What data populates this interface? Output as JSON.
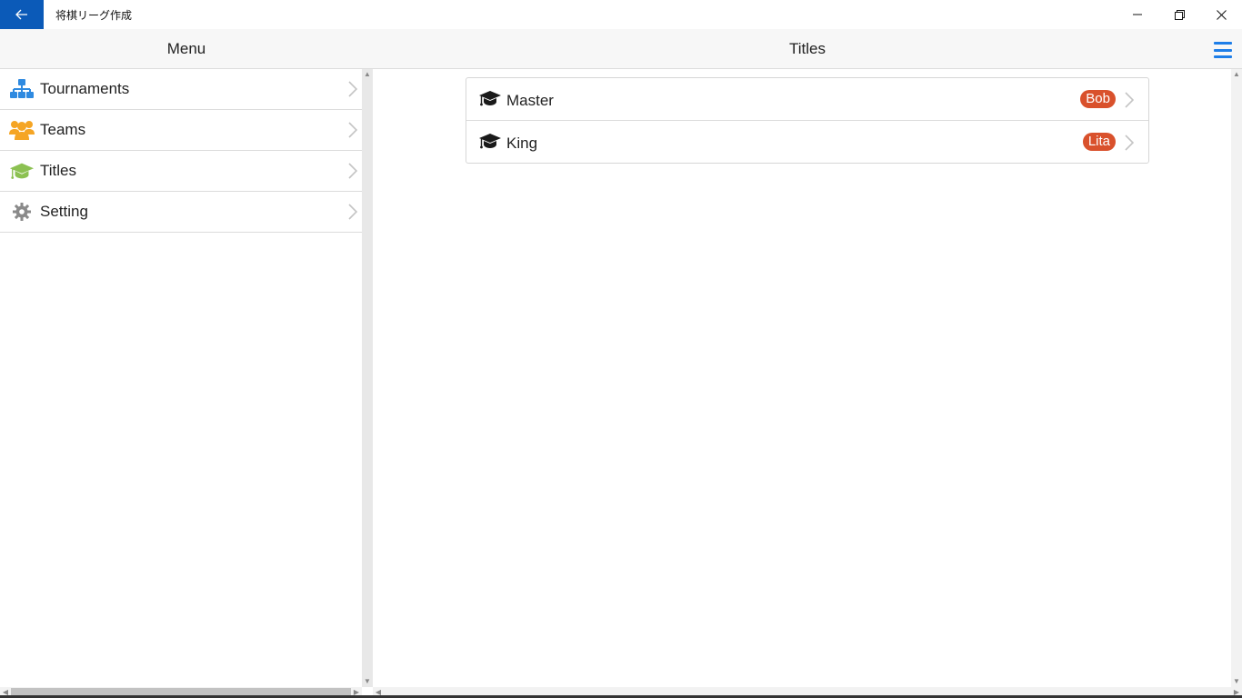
{
  "window": {
    "app_title": "将棋リーグ作成"
  },
  "header": {
    "menu_title": "Menu",
    "page_title": "Titles"
  },
  "sidebar": {
    "items": [
      {
        "label": "Tournaments",
        "icon": "sitemap-icon",
        "color": "#2f8ae0"
      },
      {
        "label": "Teams",
        "icon": "users-icon",
        "color": "#f5a524"
      },
      {
        "label": "Titles",
        "icon": "graduation-cap-icon",
        "color": "#8cc152"
      },
      {
        "label": "Setting",
        "icon": "gear-icon",
        "color": "#8a8a8a"
      }
    ]
  },
  "titles": {
    "rows": [
      {
        "label": "Master",
        "badge": "Bob",
        "icon": "graduation-cap-icon"
      },
      {
        "label": "King",
        "badge": "Lita",
        "icon": "graduation-cap-icon"
      }
    ],
    "badge_color": "#d9512c"
  },
  "colors": {
    "accent": "#1e7ee8",
    "back_button": "#0b5ab8"
  }
}
